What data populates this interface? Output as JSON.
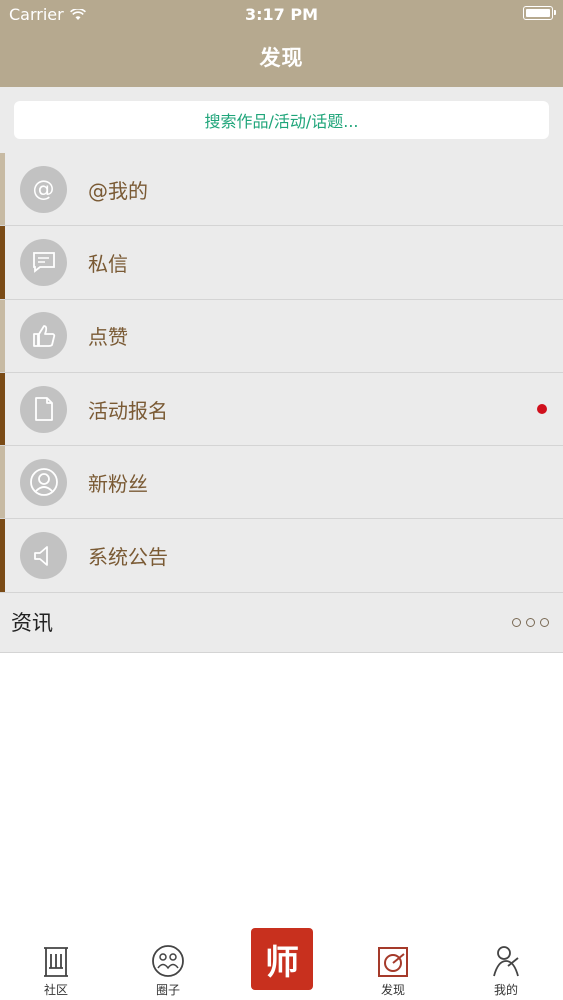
{
  "status": {
    "carrier": "Carrier",
    "time": "3:17 PM"
  },
  "header": {
    "title": "发现"
  },
  "search": {
    "placeholder": "搜索作品/活动/话题..."
  },
  "list": [
    {
      "label": "@我的",
      "icon": "at-icon",
      "accent": "light",
      "badge": false
    },
    {
      "label": "私信",
      "icon": "message-icon",
      "accent": "dark",
      "badge": false
    },
    {
      "label": "点赞",
      "icon": "thumbs-up-icon",
      "accent": "light",
      "badge": false
    },
    {
      "label": "活动报名",
      "icon": "document-icon",
      "accent": "dark",
      "badge": true
    },
    {
      "label": "新粉丝",
      "icon": "user-icon",
      "accent": "light",
      "badge": false
    },
    {
      "label": "系统公告",
      "icon": "speaker-icon",
      "accent": "dark",
      "badge": false
    }
  ],
  "news": {
    "label": "资讯"
  },
  "tabs": [
    {
      "label": "社区",
      "icon": "community-icon"
    },
    {
      "label": "圈子",
      "icon": "circle-group-icon"
    },
    {
      "label": "",
      "icon": "seal-logo-icon",
      "seal_text": "师"
    },
    {
      "label": "发现",
      "icon": "discover-icon"
    },
    {
      "label": "我的",
      "icon": "profile-icon"
    }
  ],
  "colors": {
    "header": "#b6a98f",
    "accent_green": "#1fa57a",
    "badge_red": "#d0101c",
    "bar_dark": "#7a4b16",
    "bar_light": "#c7baa3",
    "seal": "#c8301e"
  }
}
